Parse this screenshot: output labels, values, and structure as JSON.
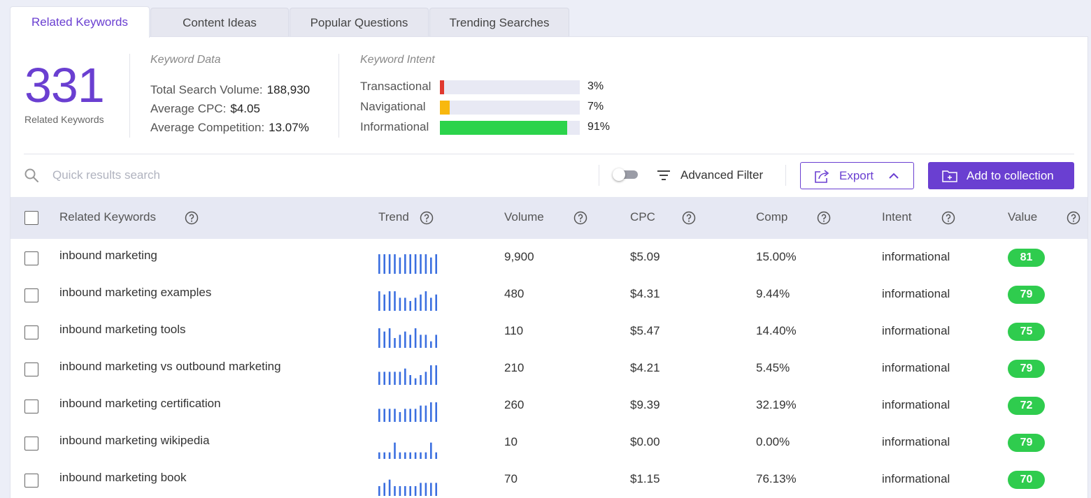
{
  "tabs": [
    {
      "label": "Related Keywords",
      "active": true
    },
    {
      "label": "Content Ideas",
      "active": false
    },
    {
      "label": "Popular Questions",
      "active": false
    },
    {
      "label": "Trending Searches",
      "active": false
    }
  ],
  "summary": {
    "count": "331",
    "count_label": "Related Keywords",
    "keyword_data": {
      "title": "Keyword Data",
      "rows": [
        {
          "label": "Total Search Volume:",
          "value": "188,930"
        },
        {
          "label": "Average CPC:",
          "value": "$4.05"
        },
        {
          "label": "Average Competition:",
          "value": "13.07%"
        }
      ]
    },
    "keyword_intent": {
      "title": "Keyword Intent",
      "rows": [
        {
          "label": "Transactional",
          "percent": 3,
          "percent_label": "3%",
          "color": "#e0382f"
        },
        {
          "label": "Navigational",
          "percent": 7,
          "percent_label": "7%",
          "color": "#f8b80e"
        },
        {
          "label": "Informational",
          "percent": 91,
          "percent_label": "91%",
          "color": "#2bd34b"
        }
      ]
    }
  },
  "toolbar": {
    "search_placeholder": "Quick results search",
    "advanced_filter_label": "Advanced Filter",
    "toggle_on": false,
    "export_label": "Export",
    "add_collection_label": "Add to collection",
    "accent_color": "#6a3fd1"
  },
  "table": {
    "columns": [
      "Related Keywords",
      "Trend",
      "Volume",
      "CPC",
      "Comp",
      "Intent",
      "Value"
    ],
    "rows": [
      {
        "keyword": "inbound marketing",
        "trend": [
          6,
          6,
          6,
          6,
          5,
          6,
          6,
          6,
          6,
          6,
          5,
          6
        ],
        "volume": "9,900",
        "cpc": "$5.09",
        "comp": "15.00%",
        "intent": "informational",
        "value": "81"
      },
      {
        "keyword": "inbound marketing examples",
        "trend": [
          6,
          5,
          6,
          6,
          4,
          4,
          3,
          4,
          5,
          6,
          4,
          5
        ],
        "volume": "480",
        "cpc": "$4.31",
        "comp": "9.44%",
        "intent": "informational",
        "value": "79"
      },
      {
        "keyword": "inbound marketing tools",
        "trend": [
          6,
          5,
          6,
          3,
          4,
          5,
          4,
          6,
          4,
          4,
          2,
          4
        ],
        "volume": "110",
        "cpc": "$5.47",
        "comp": "14.40%",
        "intent": "informational",
        "value": "75"
      },
      {
        "keyword": "inbound marketing vs outbound marketing",
        "trend": [
          4,
          4,
          4,
          4,
          4,
          5,
          3,
          2,
          3,
          4,
          6,
          6
        ],
        "volume": "210",
        "cpc": "$4.21",
        "comp": "5.45%",
        "intent": "informational",
        "value": "79"
      },
      {
        "keyword": "inbound marketing certification",
        "trend": [
          4,
          4,
          4,
          4,
          3,
          4,
          4,
          4,
          5,
          5,
          6,
          6
        ],
        "volume": "260",
        "cpc": "$9.39",
        "comp": "32.19%",
        "intent": "informational",
        "value": "72"
      },
      {
        "keyword": "inbound marketing wikipedia",
        "trend": [
          2,
          2,
          2,
          5,
          2,
          2,
          2,
          2,
          2,
          2,
          5,
          2
        ],
        "volume": "10",
        "cpc": "$0.00",
        "comp": "0.00%",
        "intent": "informational",
        "value": "79"
      },
      {
        "keyword": "inbound marketing book",
        "trend": [
          3,
          4,
          5,
          3,
          3,
          3,
          3,
          3,
          4,
          4,
          4,
          4
        ],
        "volume": "70",
        "cpc": "$1.15",
        "comp": "76.13%",
        "intent": "informational",
        "value": "70"
      }
    ],
    "trend_color": "#3b6fe0",
    "value_badge_color": "#2fcc4e"
  }
}
